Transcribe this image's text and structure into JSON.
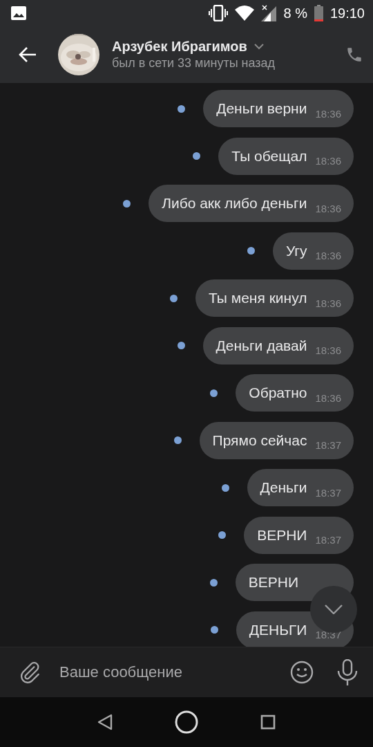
{
  "status_bar": {
    "battery": "8 %",
    "time": "19:10"
  },
  "header": {
    "name": "Арзубек Ибрагимов",
    "status": "был в сети 33 минуты назад"
  },
  "messages": [
    {
      "text": "Деньги верни",
      "time": "18:36",
      "unread": true
    },
    {
      "text": "Ты обещал",
      "time": "18:36",
      "unread": true
    },
    {
      "text": "Либо акк либо деньги",
      "time": "18:36",
      "unread": true
    },
    {
      "text": "Угу",
      "time": "18:36",
      "unread": true
    },
    {
      "text": "Ты меня кинул",
      "time": "18:36",
      "unread": true
    },
    {
      "text": "Деньги давай",
      "time": "18:36",
      "unread": true
    },
    {
      "text": "Обратно",
      "time": "18:36",
      "unread": true
    },
    {
      "text": "Прямо сейчас",
      "time": "18:37",
      "unread": true
    },
    {
      "text": "Деньги",
      "time": "18:37",
      "unread": true
    },
    {
      "text": "ВЕРНИ",
      "time": "18:37",
      "unread": true
    },
    {
      "text": "ВЕРНИ",
      "unread": true
    },
    {
      "text": "ДЕНЬГИ",
      "time": "18:37",
      "unread": true
    }
  ],
  "composer": {
    "placeholder": "Ваше сообщение"
  }
}
